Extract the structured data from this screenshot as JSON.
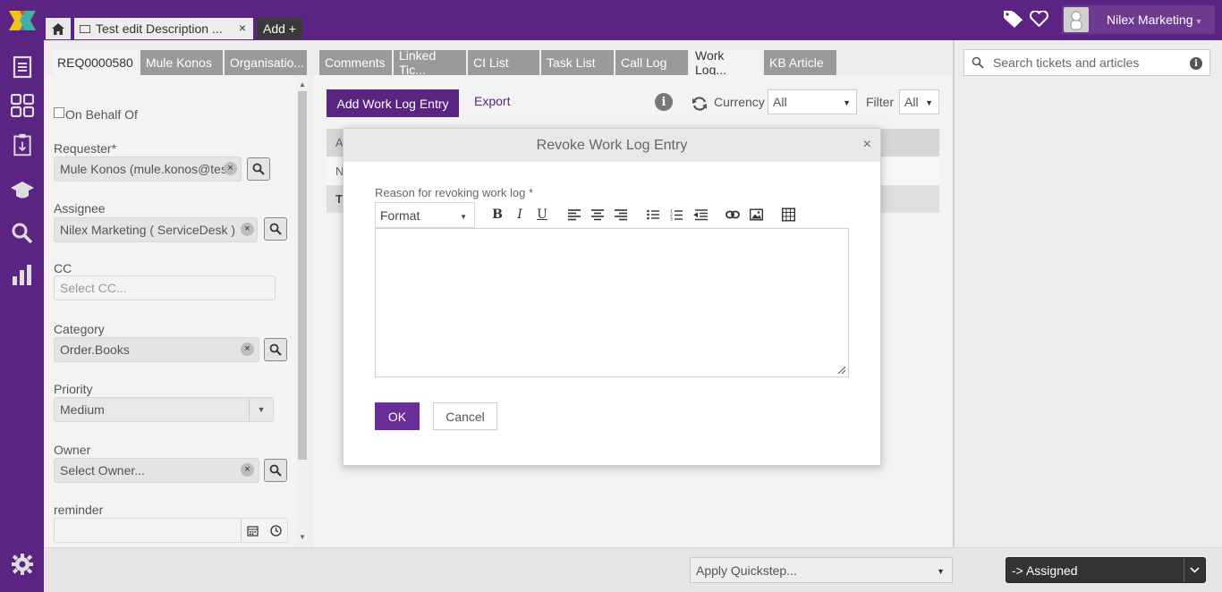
{
  "header": {
    "ticket_tab_title": "Test edit Description ...",
    "ticket_tab_close": "×",
    "add_tab_label": "Add +",
    "user_name": "Nilex Marketing"
  },
  "info_tabs": [
    {
      "label": "REQ0000580",
      "active": true
    },
    {
      "label": "Mule Konos",
      "active": false
    },
    {
      "label": "Organisatio...",
      "active": false
    }
  ],
  "form": {
    "on_behalf_of_label": "On Behalf Of",
    "requester_label": "Requester*",
    "requester_value": "Mule Konos (mule.konos@tes",
    "assignee_label": "Assignee",
    "assignee_value": "Nilex Marketing ( ServiceDesk )",
    "cc_label": "CC",
    "cc_placeholder": "Select CC...",
    "category_label": "Category",
    "category_value": "Order.Books",
    "priority_label": "Priority",
    "priority_value": "Medium",
    "owner_label": "Owner",
    "owner_placeholder": "Select Owner...",
    "reminder_label": "reminder"
  },
  "main_tabs": [
    {
      "label": "Comments",
      "active": false
    },
    {
      "label": "Linked Tic...",
      "active": false
    },
    {
      "label": "CI List",
      "active": false
    },
    {
      "label": "Task List",
      "active": false
    },
    {
      "label": "Call Log",
      "active": false
    },
    {
      "label": "Work Log...",
      "active": true
    },
    {
      "label": "KB Article",
      "active": false
    }
  ],
  "worklog": {
    "add_button": "Add Work Log Entry",
    "export_link": "Export",
    "info_glyph": "i",
    "currency_label": "Currency",
    "currency_value": "All",
    "filter_label": "Filter",
    "filter_value": "All",
    "grid_row_letters": [
      "A",
      "N",
      "T"
    ]
  },
  "kb": {
    "search_placeholder": "Search tickets and articles",
    "info_glyph": "i"
  },
  "bottom": {
    "quickstep_placeholder": "Apply Quickstep...",
    "status_value": "-> Assigned"
  },
  "modal": {
    "title": "Revoke Work Log Entry",
    "close_glyph": "×",
    "reason_label": "Reason for revoking work log *",
    "format_select": "Format",
    "bold": "B",
    "italic": "I",
    "underline": "U",
    "ok_label": "OK",
    "cancel_label": "Cancel"
  },
  "colors": {
    "brand_purple": "#5c2482",
    "ok_purple": "#6a2d9a",
    "tab_gray": "#9a9a9a",
    "status_dark": "#333333"
  }
}
